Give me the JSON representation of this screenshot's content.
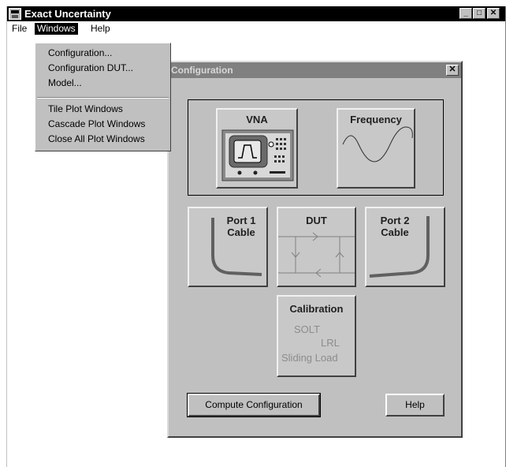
{
  "window": {
    "title": "Exact Uncertainty",
    "controls": {
      "minimize": "_",
      "maximize": "□",
      "close": "✕"
    }
  },
  "menubar": {
    "file": "File",
    "windows": "Windows",
    "help": "Help"
  },
  "windows_menu": {
    "items": [
      "Configuration...",
      "Configuration DUT...",
      "Model...",
      "Tile Plot Windows",
      "Cascade Plot Windows",
      "Close All Plot Windows"
    ]
  },
  "dialog": {
    "title": "Configuration",
    "close": "✕",
    "tiles": {
      "vna": "VNA",
      "frequency": "Frequency",
      "port1": [
        "Port 1",
        "Cable"
      ],
      "dut": "DUT",
      "port2": [
        "Port 2",
        "Cable"
      ],
      "calibration": "Calibration",
      "cal_methods": [
        "SOLT",
        "LRL",
        "Sliding Load"
      ]
    },
    "buttons": {
      "compute": "Compute Configuration",
      "help": "Help"
    }
  },
  "colors": {
    "titlebar": "#000000",
    "dialog_title": "#808080",
    "face": "#c0c0c0"
  }
}
